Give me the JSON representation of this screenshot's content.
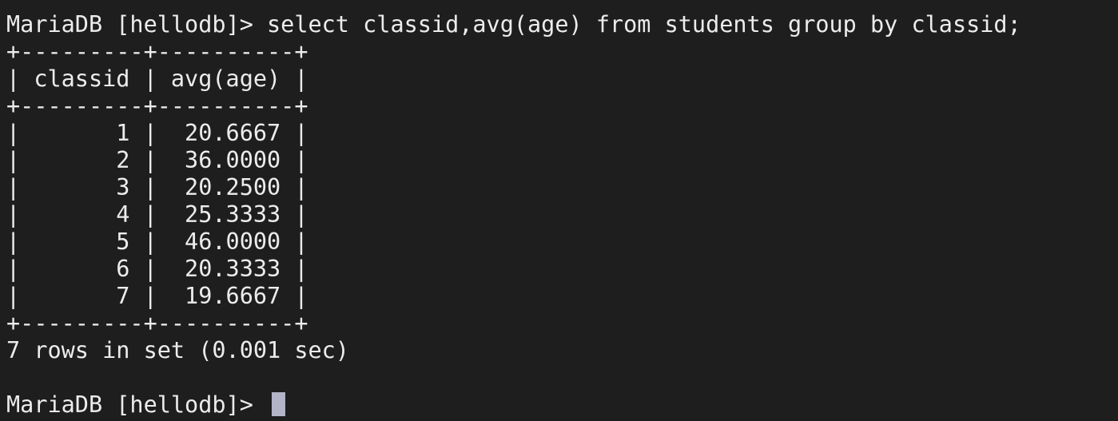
{
  "terminal": {
    "prompt": "MariaDB [hellodb]> ",
    "command": "select classid,avg(age) from students group by classid;",
    "border": "+---------+----------+",
    "header_row": "| classid | avg(age) |",
    "rows": [
      "|       1 |  20.6667 |",
      "|       2 |  36.0000 |",
      "|       3 |  20.2500 |",
      "|       4 |  25.3333 |",
      "|       5 |  46.0000 |",
      "|       6 |  20.3333 |",
      "|       7 |  19.6667 |"
    ],
    "result_summary": "7 rows in set (0.001 sec)",
    "final_prompt": "MariaDB [hellodb]> "
  },
  "colors": {
    "background": "#1e1e1e",
    "text": "#ececec",
    "cursor": "#b4b4c8"
  }
}
